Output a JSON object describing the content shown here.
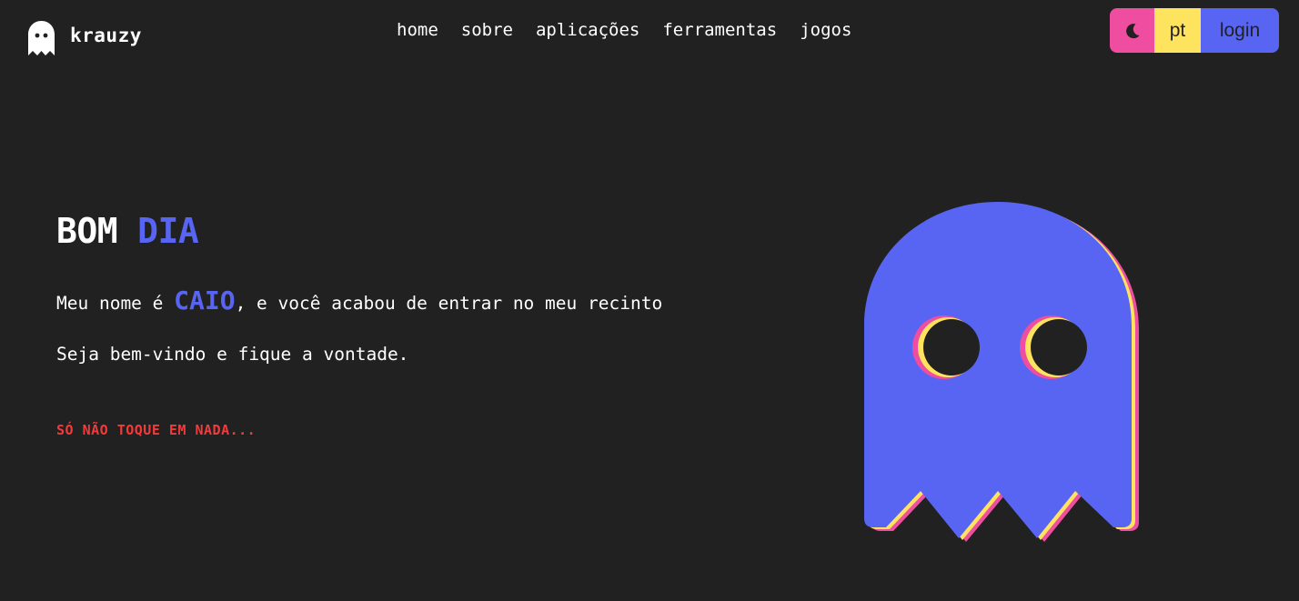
{
  "header": {
    "brand": "krauzy",
    "nav": [
      "home",
      "sobre",
      "aplicações",
      "ferramentas",
      "jogos"
    ],
    "controls": {
      "theme_icon": "moon-icon",
      "language": "pt",
      "login": "login"
    }
  },
  "hero": {
    "greeting": [
      "BOM",
      "DIA"
    ],
    "intro_before": "Meu nome é ",
    "intro_name": "CAIO",
    "intro_after": ", e você acabou de entrar no meu recinto",
    "welcome": "Seja bem-vindo e fique a vontade.",
    "warning": "SÓ NÃO TOQUE EM NADA..."
  },
  "colors": {
    "background": "#212121",
    "accent_blue": "#5865f2",
    "accent_pink": "#ef4da0",
    "accent_yellow": "#fde35e",
    "warning_red": "#f23b3b"
  },
  "icons": {
    "logo": "ghost-icon",
    "hero_image": "ghost-icon"
  }
}
